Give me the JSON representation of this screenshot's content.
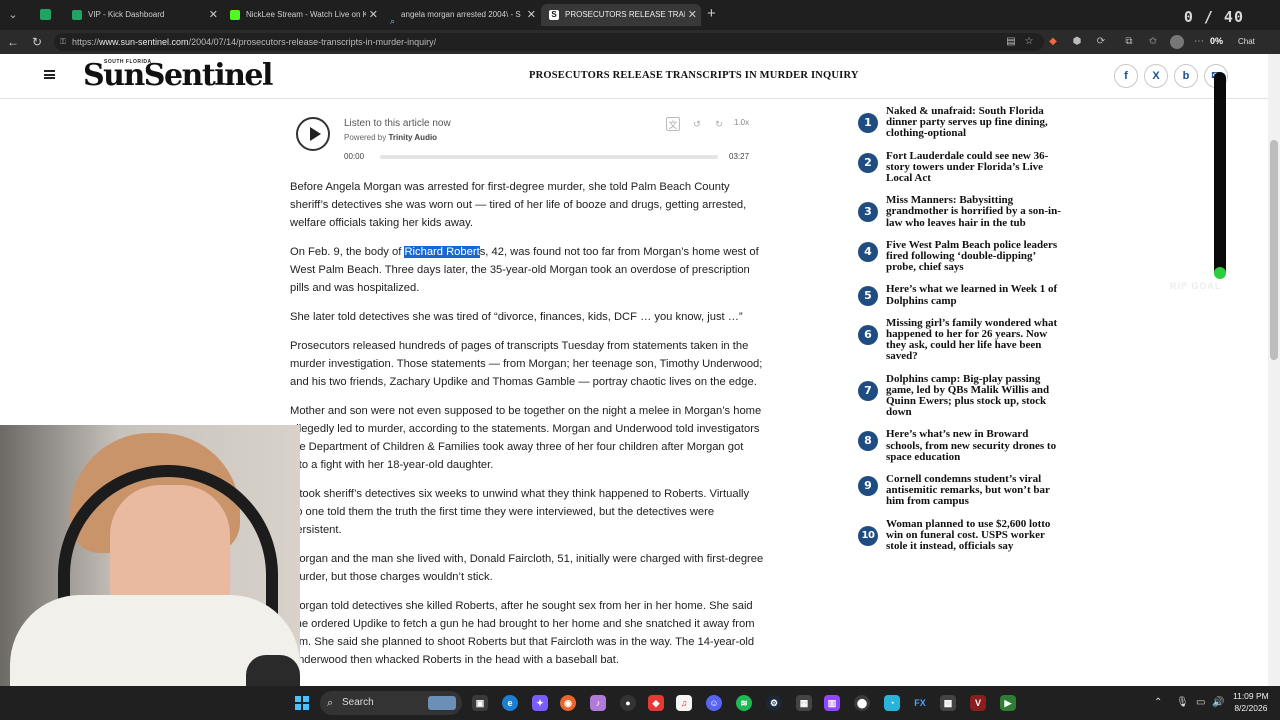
{
  "browser": {
    "counter": "0 / 40",
    "tabs": [
      {
        "title": "VIP - Kick Dashboard",
        "favicon_color": "#1fa463"
      },
      {
        "title": "NickLee Stream - Watch Live on Ki",
        "favicon_color": "#53fc18"
      },
      {
        "title": "angela morgan arrested 2004\\ - S",
        "favicon_color": "#4c8bf5"
      },
      {
        "title": "PROSECUTORS RELEASE TRANSCR",
        "favicon_color": "#eeeeee"
      }
    ],
    "url_scheme": "https://",
    "url_domain": "www.sun-sentinel.com",
    "url_path": "/2004/07/14/prosecutors-release-transcripts-in-murder-inquiry/",
    "zoom_badge": "0%",
    "chat_label": "Chat"
  },
  "site": {
    "logo_small": "SOUTH FLORIDA",
    "logo": "SunSentinel",
    "header_title": "PROSECUTORS RELEASE TRANSCRIPTS IN MURDER INQUIRY",
    "share": [
      "f",
      "X",
      "b"
    ]
  },
  "player": {
    "listen": "Listen to this article now",
    "powered_prefix": "Powered by ",
    "powered_brand": "Trinity Audio",
    "speed": "1.0x",
    "time_start": "00:00",
    "time_end": "03:27"
  },
  "article": {
    "p1": "Before Angela Morgan was arrested for first-degree murder, she told Palm Beach County sheriff’s detectives she was worn out — tired of her life of booze and drugs, getting arrested, welfare officials taking her kids away.",
    "p2_before": "On Feb. 9, the body of ",
    "p2_highlight": "Richard Robert",
    "p2_after": "s, 42, was found not too far from Morgan’s home west of West Palm Beach. Three days later, the 35-year-old Morgan took an overdose of prescription pills and was hospitalized.",
    "p3": "She later told detectives she was tired of “divorce, finances, kids, DCF … you know, just …”",
    "p4": "Prosecutors released hundreds of pages of transcripts Tuesday from statements taken in the murder investigation. Those statements — from Morgan; her teenage son, Timothy Underwood; and his two friends, Zachary Updike and Thomas Gamble — portray chaotic lives on the edge.",
    "p5": "Mother and son were not even supposed to be together on the night a melee in Morgan’s home allegedly led to murder, according to the statements. Morgan and Underwood told investigators the Department of Children & Families took away three of her four children after Morgan got into a fight with her 18-year-old daughter.",
    "p6": "It took sheriff’s detectives six weeks to unwind what they think happened to Roberts. Virtually no one told them the truth the first time they were interviewed, but the detectives were persistent.",
    "p7": "Morgan and the man she lived with, Donald Faircloth, 51, initially were charged with first-degree murder, but those charges wouldn’t stick.",
    "p8": "Morgan told detectives she killed Roberts, after he sought sex from her in her home. She said she ordered Updike to fetch a gun he had brought to her home and she snatched it away from him. She said she planned to shoot Roberts but that Faircloth was in the way. The 14-year-old Underwood then whacked Roberts in the head with a baseball bat."
  },
  "most_read": [
    {
      "n": "1",
      "title": "Naked & unafraid: South Florida dinner party serves up fine dining, clothing-optional"
    },
    {
      "n": "2",
      "title": "Fort Lauderdale could see new 36-story towers under Florida’s Live Local Act"
    },
    {
      "n": "3",
      "title": "Miss Manners: Babysitting grandmother is horrified by a son-in-law who leaves hair in the tub"
    },
    {
      "n": "4",
      "title": "Five West Palm Beach police leaders fired following ‘double-dipping’ probe, chief says"
    },
    {
      "n": "5",
      "title": "Here’s what we learned in Week 1 of Dolphins camp"
    },
    {
      "n": "6",
      "title": "Missing girl’s family wondered what happened to her for 26 years. Now they ask, could her life have been saved?"
    },
    {
      "n": "7",
      "title": "Dolphins camp: Big-play passing game, led by QBs Malik Willis and Quinn Ewers; plus stock up, stock down"
    },
    {
      "n": "8",
      "title": "Here’s what’s new in Broward schools, from new security drones to space education"
    },
    {
      "n": "9",
      "title": "Cornell condemns student’s viral antisemitic remarks, but won’t bar him from campus"
    },
    {
      "n": "10",
      "title": "Woman planned to use $2,600 lotto win on funeral cost. USPS worker stole it instead, officials say"
    }
  ],
  "overlay": {
    "goal_text": "RIP GOAL"
  },
  "taskbar": {
    "search_label": "Search",
    "time": "11:09 PM",
    "date": "8/2/2026"
  }
}
